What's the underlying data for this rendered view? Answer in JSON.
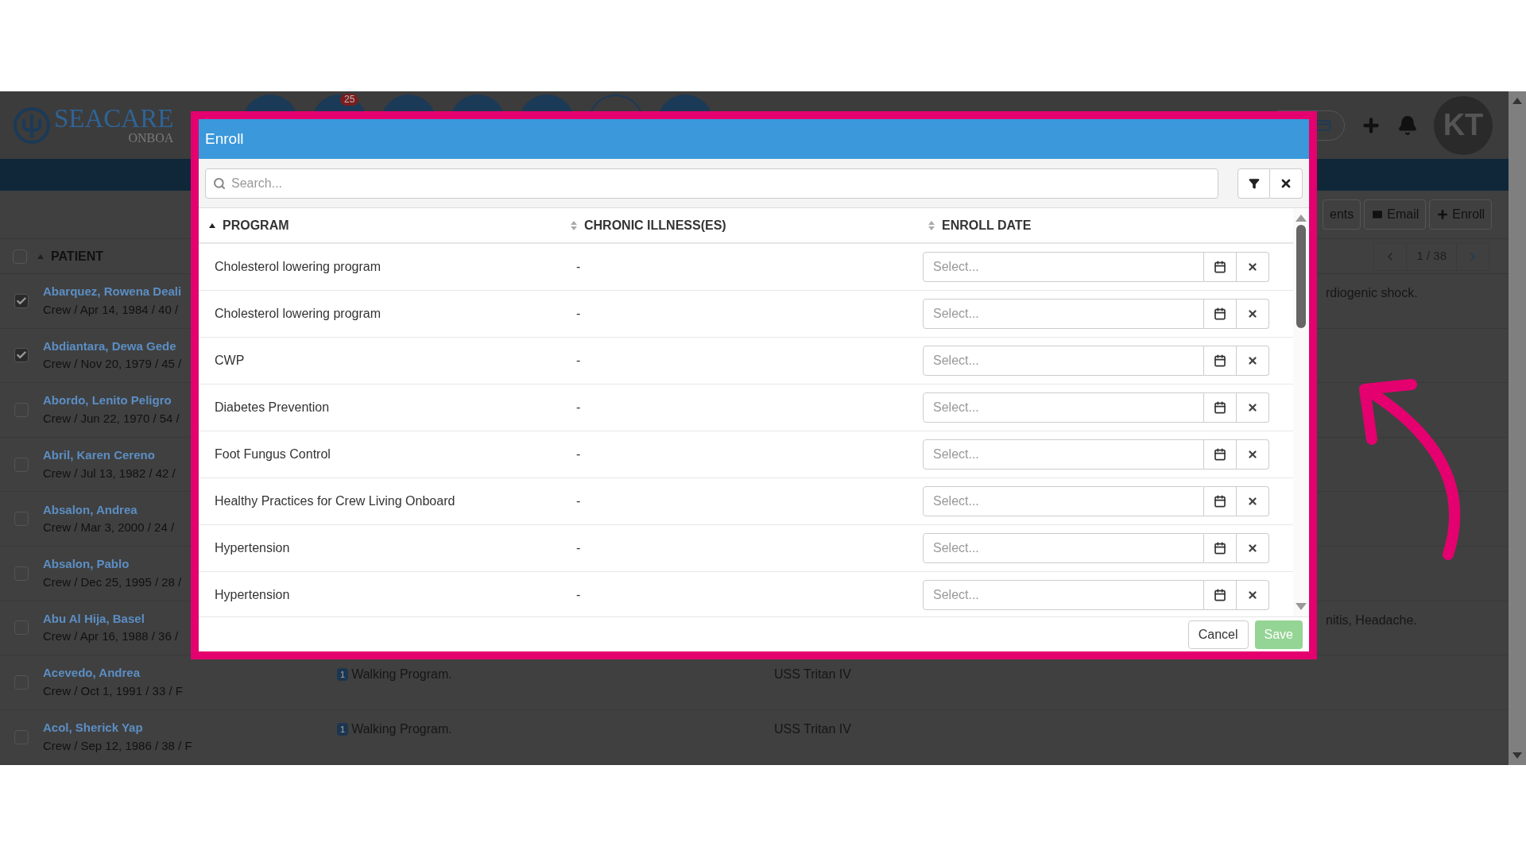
{
  "header": {
    "logo": "SEACARE",
    "logo_sub": "ONBOA",
    "nav_badge": "25",
    "avatar": "KT"
  },
  "toolbar": [
    "ents",
    "Email",
    "Enroll"
  ],
  "patients": {
    "column": "PATIENT",
    "all_checked": false,
    "pager": "1 / 38",
    "rows": [
      {
        "name": "Abarquez, Rowena Deali",
        "info": "Crew / Apr 14, 1984 / 40 /",
        "checked": true,
        "note": "rdiogenic shock."
      },
      {
        "name": "Abdiantara, Dewa Gede",
        "info": "Crew / Nov 20, 1979 / 45 /",
        "checked": true
      },
      {
        "name": "Abordo, Lenito Peligro",
        "info": "Crew / Jun 22, 1970 / 54 /",
        "checked": false
      },
      {
        "name": "Abril, Karen Cereno",
        "info": "Crew / Jul 13, 1982 / 42 /",
        "checked": false
      },
      {
        "name": "Absalon, Andrea",
        "info": "Crew / Mar 3, 2000 / 24 /",
        "checked": false
      },
      {
        "name": "Absalon, Pablo",
        "info": "Crew / Dec 25, 1995 / 28 /",
        "checked": false
      },
      {
        "name": "Abu Al Hija, Basel",
        "info": "Crew / Apr 16, 1988 / 36 /",
        "checked": false,
        "note": "nitis, Headache."
      },
      {
        "name": "Acevedo, Andrea",
        "info": "Crew / Oct 1, 1991 / 33 / F",
        "checked": false,
        "program_count": "1",
        "program": "Walking Program.",
        "vessel": "USS Tritan IV"
      },
      {
        "name": "Acol, Sherick Yap",
        "info": "Crew / Sep 12, 1986 / 38 / F",
        "checked": false,
        "program_count": "1",
        "program": "Walking Program.",
        "vessel": "USS Tritan IV"
      }
    ]
  },
  "modal": {
    "title": "Enroll",
    "search": {
      "placeholder": "Search..."
    },
    "columns": [
      {
        "label": "PROGRAM",
        "sorted": true
      },
      {
        "label": "CHRONIC ILLNESS(ES)",
        "sorted": false
      },
      {
        "label": "ENROLL DATE",
        "sorted": false
      }
    ],
    "rows": [
      {
        "program": "Cholesterol lowering program",
        "illness": "-",
        "date_placeholder": "Select..."
      },
      {
        "program": "Cholesterol lowering program",
        "illness": "-",
        "date_placeholder": "Select..."
      },
      {
        "program": "CWP",
        "illness": "-",
        "date_placeholder": "Select..."
      },
      {
        "program": "Diabetes Prevention",
        "illness": "-",
        "date_placeholder": "Select..."
      },
      {
        "program": "Foot Fungus Control",
        "illness": "-",
        "date_placeholder": "Select..."
      },
      {
        "program": "Healthy Practices for Crew Living Onboard",
        "illness": "-",
        "date_placeholder": "Select..."
      },
      {
        "program": "Hypertension",
        "illness": "-",
        "date_placeholder": "Select..."
      },
      {
        "program": "Hypertension",
        "illness": "-",
        "date_placeholder": "Select..."
      }
    ],
    "cancel": "Cancel",
    "save": {
      "label": "Save",
      "disabled": true
    }
  }
}
